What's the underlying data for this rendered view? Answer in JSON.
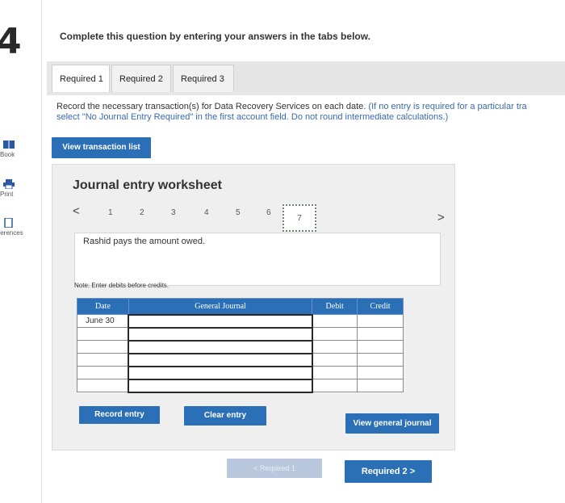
{
  "question_number": "4",
  "instruction": "Complete this question by entering your answers in the tabs below.",
  "left_rail": {
    "items": [
      {
        "label": "Book",
        "icon": "book-icon"
      },
      {
        "label": "Print",
        "icon": "printer-icon"
      },
      {
        "label": "ferences",
        "icon": "references-icon"
      }
    ]
  },
  "tabs": [
    {
      "label": "Required 1",
      "active": true
    },
    {
      "label": "Required 2",
      "active": false
    },
    {
      "label": "Required 3",
      "active": false
    }
  ],
  "record_instruction": {
    "line1_main": "Record the necessary transaction(s) for Data Recovery Services on each date.",
    "line1_note": "(If no entry is required for a particular tra",
    "line2_note": "select \"No Journal Entry Required\" in the first account field. Do not round intermediate calculations.)"
  },
  "buttons": {
    "view_transaction_list": "View transaction list",
    "record_entry": "Record entry",
    "clear_entry": "Clear entry",
    "view_general_journal": "View general journal",
    "required_prev": "< Required 1",
    "required_next": "Required 2  >"
  },
  "worksheet": {
    "title": "Journal entry worksheet",
    "prev": "<",
    "next": ">",
    "pages": [
      "1",
      "2",
      "3",
      "4",
      "5",
      "6",
      "7"
    ],
    "active_page": "7",
    "description": "Rashid pays the amount owed.",
    "note": "Note: Enter debits before credits."
  },
  "journal_table": {
    "headers": {
      "date": "Date",
      "account": "General Journal",
      "debit": "Debit",
      "credit": "Credit"
    },
    "rows": [
      {
        "date": "June 30",
        "account": "",
        "debit": "",
        "credit": ""
      },
      {
        "date": "",
        "account": "",
        "debit": "",
        "credit": ""
      },
      {
        "date": "",
        "account": "",
        "debit": "",
        "credit": ""
      },
      {
        "date": "",
        "account": "",
        "debit": "",
        "credit": ""
      },
      {
        "date": "",
        "account": "",
        "debit": "",
        "credit": ""
      },
      {
        "date": "",
        "account": "",
        "debit": "",
        "credit": ""
      }
    ]
  },
  "colors": {
    "accent_blue": "#2b6fb6",
    "tabbar_gray": "#e6e6e6",
    "panel_gray": "#efefef"
  }
}
